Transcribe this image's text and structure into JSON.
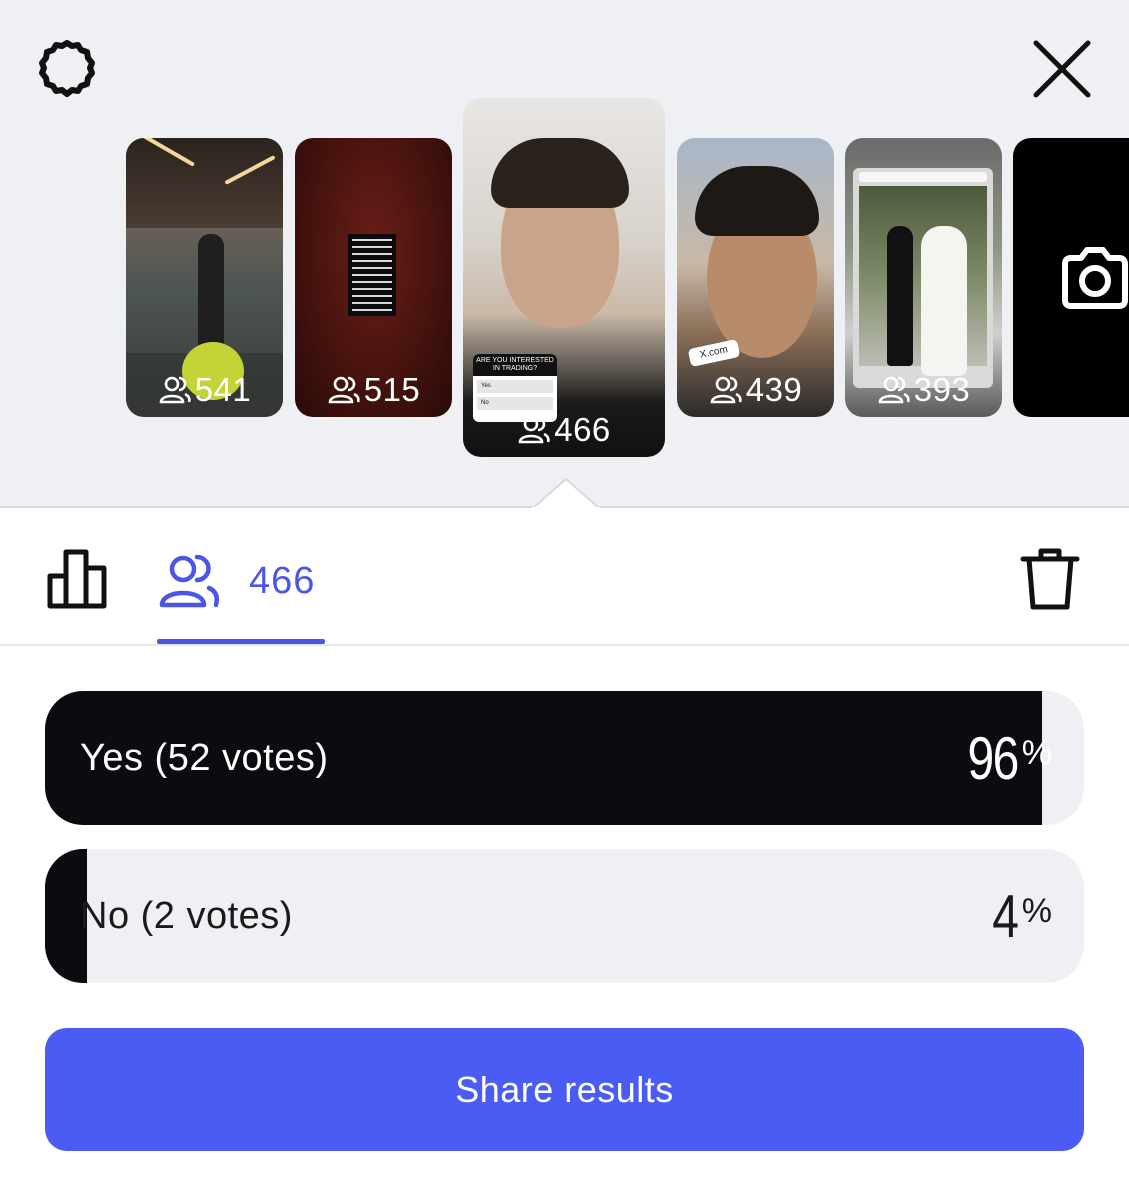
{
  "header": {
    "settings_icon": "gear-icon",
    "close_icon": "close-icon"
  },
  "stories": [
    {
      "viewers": "541"
    },
    {
      "viewers": "515"
    },
    {
      "viewers": "466",
      "selected": true,
      "poll_question": "ARE YOU INTERESTED IN TRADING?",
      "poll_options": [
        "Yes",
        "No"
      ]
    },
    {
      "viewers": "439",
      "link_sticker": "X.com"
    },
    {
      "viewers": "393"
    },
    {
      "icon": "camera-icon"
    }
  ],
  "tabs": {
    "stats_icon": "bar-chart-icon",
    "viewers_icon": "people-icon",
    "viewers_count": "466",
    "delete_icon": "trash-icon"
  },
  "poll_results": [
    {
      "label": "Yes (52 votes)",
      "percent": "96",
      "percent_sign": "%",
      "fraction": 0.96
    },
    {
      "label": "No (2 votes)",
      "percent": "4",
      "percent_sign": "%",
      "fraction": 0.04
    }
  ],
  "actions": {
    "share_label": "Share results"
  },
  "colors": {
    "accent": "#4b55e8",
    "button": "#4b5cf5",
    "bar_fill": "#0b0c10",
    "panel_bg": "#eff0f4"
  }
}
